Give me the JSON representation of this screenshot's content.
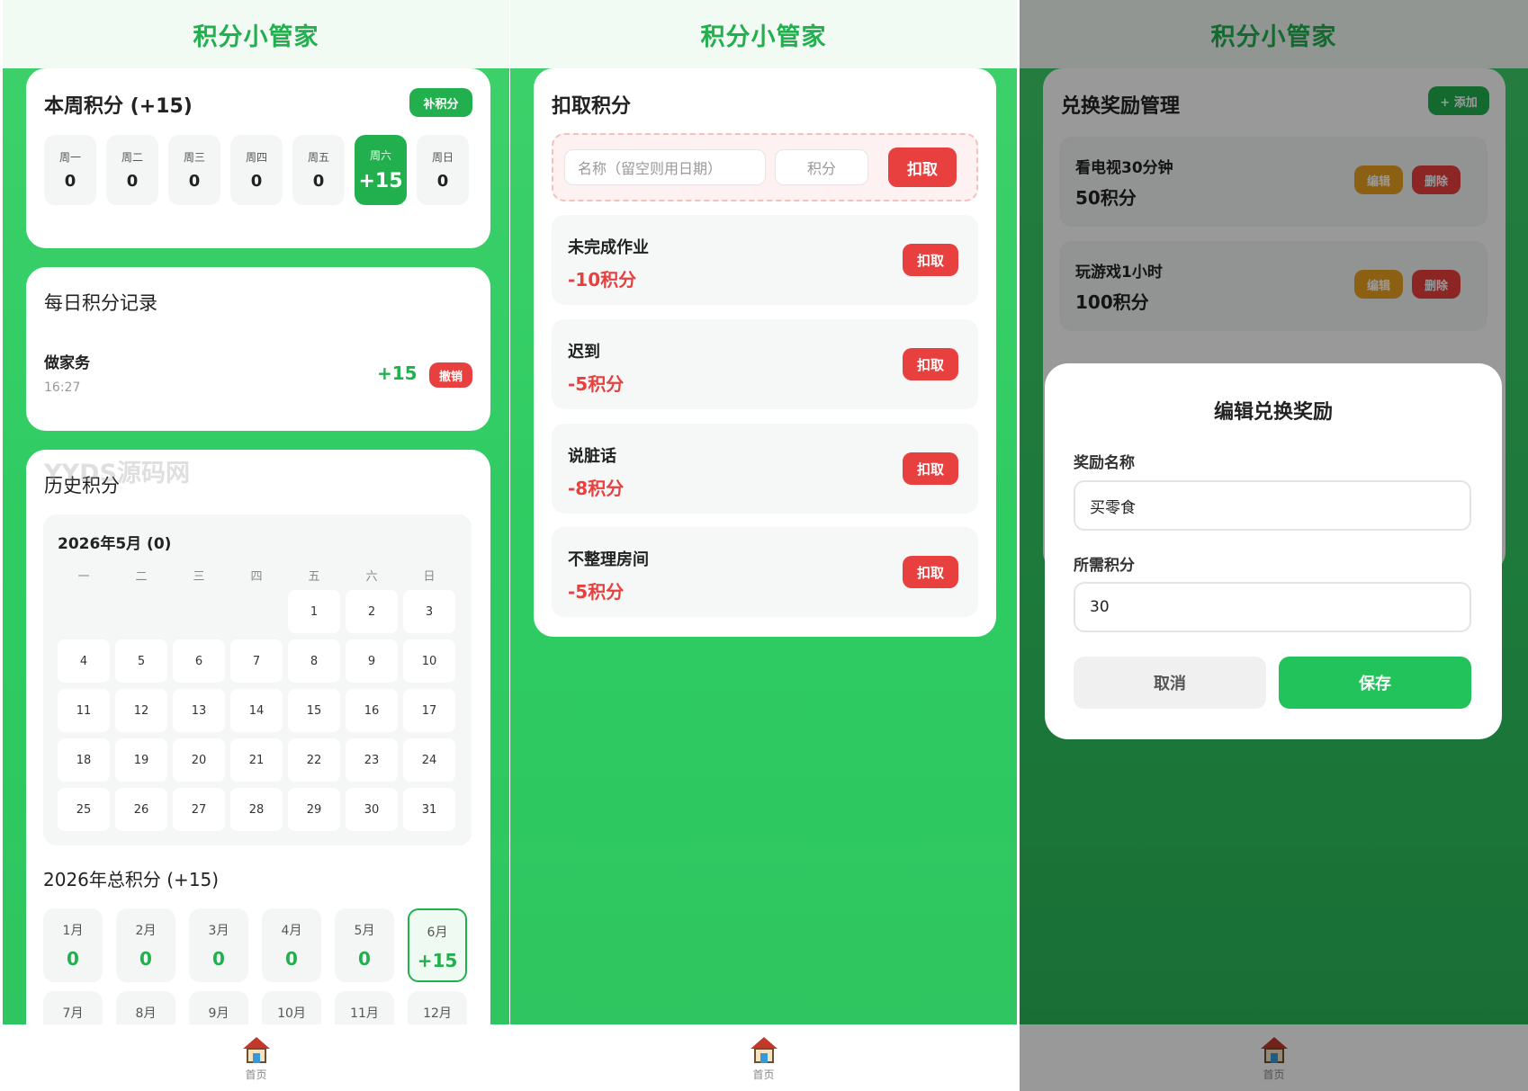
{
  "app_title": "积分小管家",
  "nav": {
    "home_label": "首页"
  },
  "screen1": {
    "week": {
      "title": "本周积分 (+15)",
      "add_button": "补积分",
      "days": [
        {
          "day": "周一",
          "value": "0"
        },
        {
          "day": "周二",
          "value": "0"
        },
        {
          "day": "周三",
          "value": "0"
        },
        {
          "day": "周四",
          "value": "0"
        },
        {
          "day": "周五",
          "value": "0"
        },
        {
          "day": "周六",
          "value": "+15"
        },
        {
          "day": "周日",
          "value": "0"
        }
      ]
    },
    "daily": {
      "title": "每日积分记录",
      "record": {
        "name": "做家务",
        "time": "16:27",
        "points": "+15",
        "undo": "撤销"
      }
    },
    "history": {
      "title": "历史积分",
      "watermark": "YYDS源码网",
      "month_title": "2026年5月 (0)",
      "weekdays": [
        "一",
        "二",
        "三",
        "四",
        "五",
        "六",
        "日"
      ],
      "dates": [
        "1",
        "2",
        "3",
        "4",
        "5",
        "6",
        "7",
        "8",
        "9",
        "10",
        "11",
        "12",
        "13",
        "14",
        "15",
        "16",
        "17",
        "18",
        "19",
        "20",
        "21",
        "22",
        "23",
        "24",
        "25",
        "26",
        "27",
        "28",
        "29",
        "30",
        "31"
      ],
      "year_title": "2026年总积分 (+15)",
      "months": [
        {
          "m": "1月",
          "v": "0"
        },
        {
          "m": "2月",
          "v": "0"
        },
        {
          "m": "3月",
          "v": "0"
        },
        {
          "m": "4月",
          "v": "0"
        },
        {
          "m": "5月",
          "v": "0"
        },
        {
          "m": "6月",
          "v": "+15"
        },
        {
          "m": "7月",
          "v": ""
        },
        {
          "m": "8月",
          "v": ""
        },
        {
          "m": "9月",
          "v": ""
        },
        {
          "m": "10月",
          "v": ""
        },
        {
          "m": "11月",
          "v": ""
        },
        {
          "m": "12月",
          "v": ""
        }
      ]
    }
  },
  "screen2": {
    "title": "扣取积分",
    "name_placeholder": "名称（留空则用日期）",
    "points_placeholder": "积分",
    "deduct_button": "扣取",
    "items": [
      {
        "name": "未完成作业",
        "points": "-10积分",
        "button": "扣取"
      },
      {
        "name": "迟到",
        "points": "-5积分",
        "button": "扣取"
      },
      {
        "name": "说脏话",
        "points": "-8积分",
        "button": "扣取"
      },
      {
        "name": "不整理房间",
        "points": "-5积分",
        "button": "扣取"
      }
    ]
  },
  "screen3": {
    "title": "兑换奖励管理",
    "add_button": "+ 添加",
    "rewards": [
      {
        "name": "看电视30分钟",
        "points": "50积分",
        "edit": "编辑",
        "delete": "删除"
      },
      {
        "name": "玩游戏1小时",
        "points": "100积分",
        "edit": "编辑",
        "delete": "删除"
      }
    ],
    "modal": {
      "title": "编辑兑换奖励",
      "name_label": "奖励名称",
      "name_value": "买零食",
      "points_label": "所需积分",
      "points_value": "30",
      "cancel": "取消",
      "save": "保存"
    }
  },
  "colors": {
    "accent": "#22b04f",
    "danger": "#e8403f",
    "warning": "#e8a020"
  }
}
